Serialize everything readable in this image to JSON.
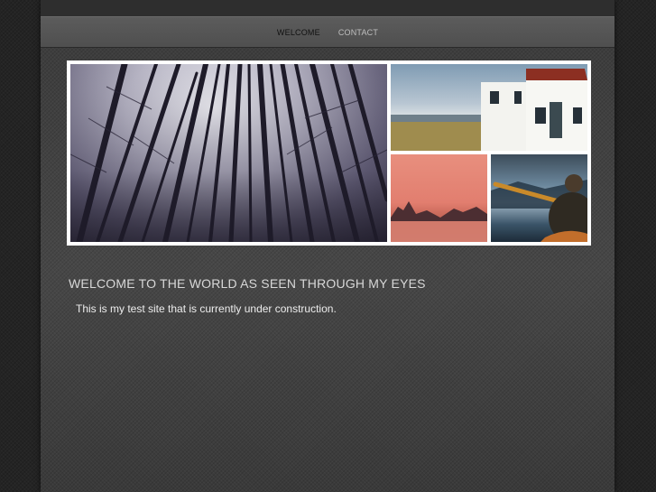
{
  "nav": {
    "items": [
      {
        "label": "WELCOME",
        "active": true
      },
      {
        "label": "CONTACT",
        "active": false
      }
    ]
  },
  "banner": {
    "photos": [
      "forest-photo",
      "lighthouse-photo",
      "sunset-sea-stacks-photo",
      "kayaker-photo"
    ]
  },
  "main": {
    "heading": "WELCOME TO THE WORLD AS SEEN THROUGH MY EYES",
    "body": "This is my test site that is currently under construction."
  },
  "colors": {
    "page_background": "#242424",
    "content_background": "#444444",
    "navbar": "#555555",
    "nav_active": "#111111",
    "nav_inactive": "#bfbfbf",
    "heading_text": "#d8d8d8",
    "body_text": "#ededed"
  }
}
